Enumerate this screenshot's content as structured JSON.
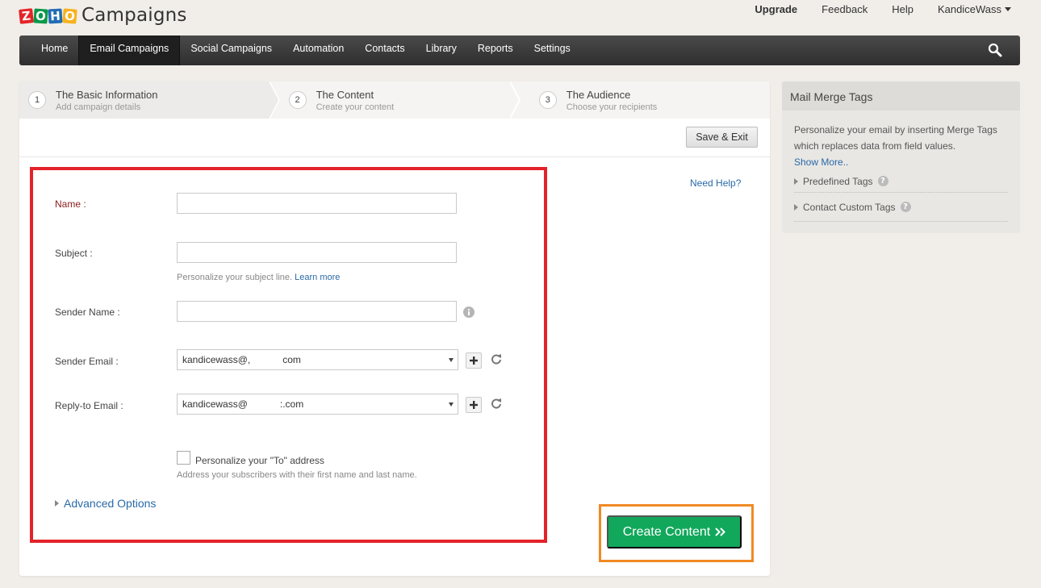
{
  "app": {
    "logo_letters": [
      "Z",
      "O",
      "H",
      "O"
    ],
    "logo_text": "Campaigns"
  },
  "topnav": {
    "upgrade": "Upgrade",
    "feedback": "Feedback",
    "help": "Help",
    "user": "KandiceWass"
  },
  "mainnav": {
    "items": [
      "Home",
      "Email Campaigns",
      "Social Campaigns",
      "Automation",
      "Contacts",
      "Library",
      "Reports",
      "Settings"
    ],
    "active": "Email Campaigns"
  },
  "steps": [
    {
      "num": "1",
      "title": "The Basic Information",
      "sub": "Add campaign details"
    },
    {
      "num": "2",
      "title": "The Content",
      "sub": "Create your content"
    },
    {
      "num": "3",
      "title": "The Audience",
      "sub": "Choose your recipients"
    }
  ],
  "toolbar": {
    "save_exit": "Save & Exit"
  },
  "need_help": "Need Help?",
  "form": {
    "name_label": "Name :",
    "subject_label": "Subject :",
    "subject_hint": "Personalize your subject line.",
    "learn_more": "Learn more",
    "sender_name_label": "Sender Name :",
    "sender_email_label": "Sender Email :",
    "sender_email_value": "kandicewass@,            com",
    "reply_to_label": "Reply-to Email :",
    "reply_to_value": "kandicewass@            :.com",
    "personalize_label": "Personalize your \"To\" address",
    "personalize_hint": "Address your subscribers with their first name and last name.",
    "advanced_options": "Advanced Options"
  },
  "create_button": "Create Content",
  "merge_panel": {
    "title": "Mail Merge Tags",
    "description": "Personalize your email by inserting Merge Tags which replaces data from field values.",
    "show_more": "Show More..",
    "predefined": "Predefined Tags",
    "custom": "Contact Custom Tags"
  },
  "colors": {
    "nav_bg": "#3a3a3a",
    "highlight_red": "#e42229",
    "highlight_orange": "#f08a24",
    "create_green": "#12a85b",
    "link_blue": "#2a6aa8"
  }
}
